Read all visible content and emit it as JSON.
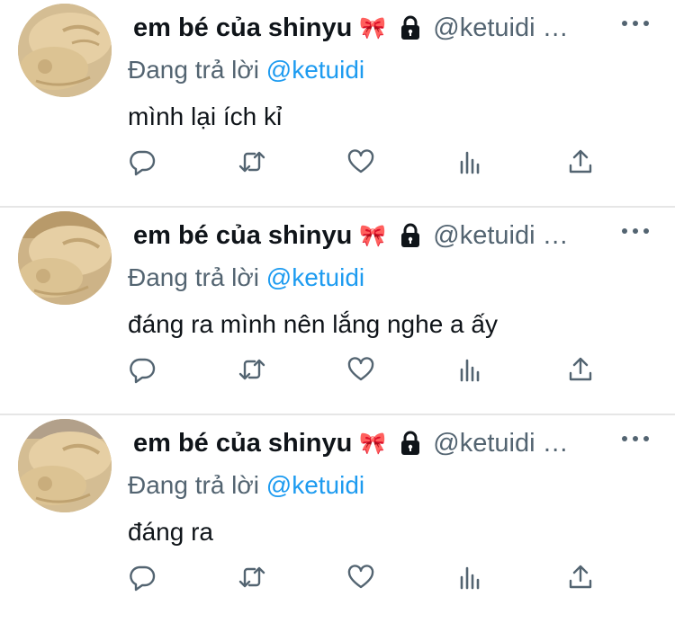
{
  "tweets": [
    {
      "display_name": "em bé của shinyu",
      "bow": "🎀",
      "handle": "@ketuidi …",
      "replying_prefix": "Đang trả lời",
      "replying_to": "@ketuidi",
      "text": "mình lại ích kỉ"
    },
    {
      "display_name": "em bé của shinyu",
      "bow": "🎀",
      "handle": "@ketuidi …",
      "replying_prefix": "Đang trả lời",
      "replying_to": "@ketuidi",
      "text": "đáng ra mình nên lắng nghe a ấy"
    },
    {
      "display_name": "em bé của shinyu",
      "bow": "🎀",
      "handle": "@ketuidi …",
      "replying_prefix": "Đang trả lời",
      "replying_to": "@ketuidi",
      "text": "đáng ra"
    }
  ],
  "icons": {
    "reply": "reply-icon",
    "retweet": "retweet-icon",
    "like": "like-icon",
    "views": "views-icon",
    "share": "share-icon",
    "lock": "lock-icon",
    "more": "more-icon"
  },
  "colors": {
    "text": "#0f1419",
    "secondary": "#536471",
    "mention": "#1d9bf0",
    "divider": "#e6e6e6"
  }
}
